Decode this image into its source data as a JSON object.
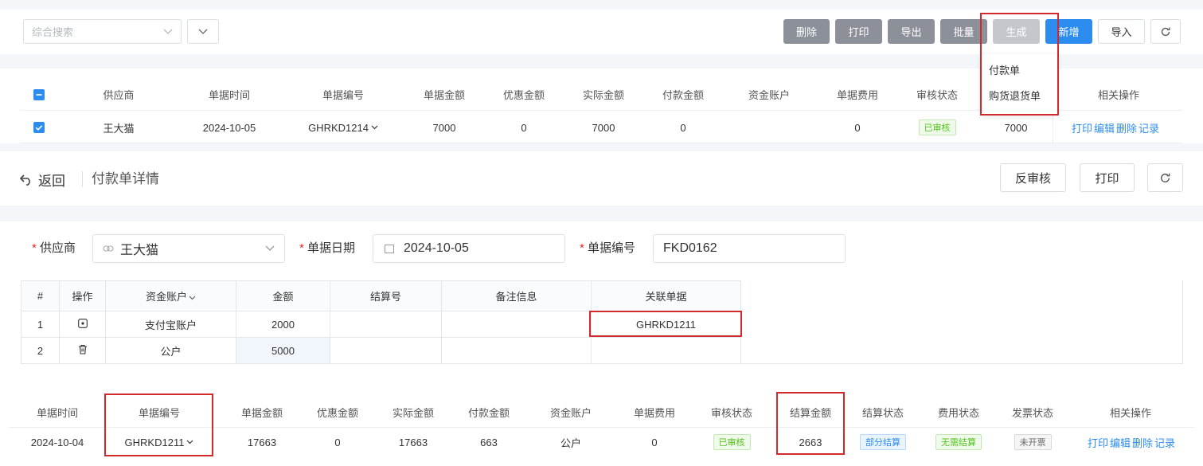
{
  "toolbar": {
    "search_placeholder": "综合搜索",
    "buttons": {
      "delete": "删除",
      "print": "打印",
      "export": "导出",
      "batch": "批量",
      "generate": "生成",
      "add": "新增",
      "import": "导入"
    },
    "generate_menu": [
      "付款单",
      "购货退货单"
    ]
  },
  "top_table": {
    "headers": [
      "供应商",
      "单据时间",
      "单据编号",
      "单据金额",
      "优惠金额",
      "实际金额",
      "付款金额",
      "资金账户",
      "单据费用",
      "审核状态",
      "",
      "相关操作"
    ],
    "row": {
      "supplier": "王大猫",
      "date": "2024-10-05",
      "number": "GHRKD1214",
      "amount": "7000",
      "discount": "0",
      "actual": "7000",
      "paid": "0",
      "account": "",
      "fee": "0",
      "status": "已审核",
      "extra": "7000",
      "actions": [
        "打印",
        "编辑",
        "删除",
        "记录"
      ]
    }
  },
  "detail": {
    "back_label": "返回",
    "title": "付款单详情",
    "unaudit": "反审核",
    "print": "打印"
  },
  "form": {
    "supplier_label": "供应商",
    "supplier_value": "王大猫",
    "date_label": "单据日期",
    "date_value": "2024-10-05",
    "number_label": "单据编号",
    "number_value": "FKD0162",
    "required_mark": "*"
  },
  "line_table": {
    "headers": [
      "#",
      "操作",
      "资金账户",
      "金额",
      "结算号",
      "备注信息",
      "关联单据"
    ],
    "rows": [
      {
        "idx": "1",
        "account": "支付宝账户",
        "amount": "2000",
        "settle": "",
        "note": "",
        "ref": "GHRKD1211"
      },
      {
        "idx": "2",
        "account": "公户",
        "amount": "5000",
        "settle": "",
        "note": "",
        "ref": ""
      }
    ]
  },
  "bottom_table": {
    "headers": [
      "单据时间",
      "单据编号",
      "单据金额",
      "优惠金额",
      "实际金额",
      "付款金额",
      "资金账户",
      "单据费用",
      "审核状态",
      "结算金额",
      "结算状态",
      "费用状态",
      "发票状态",
      "相关操作"
    ],
    "row": {
      "date": "2024-10-04",
      "number": "GHRKD1211",
      "amount": "17663",
      "discount": "0",
      "actual": "17663",
      "paid": "663",
      "account": "公户",
      "fee": "0",
      "status": "已审核",
      "settle_amount": "2663",
      "settle_status": "部分结算",
      "fee_status": "无需结算",
      "invoice_status": "未开票",
      "actions": [
        "打印",
        "编辑",
        "删除",
        "记录"
      ]
    }
  }
}
